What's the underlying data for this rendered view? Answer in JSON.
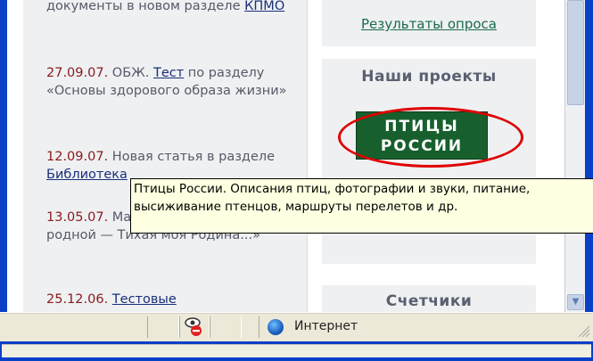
{
  "news": [
    {
      "date": "",
      "text_before": "документы в новом разделе ",
      "link": "КПМО",
      "text_after": ""
    },
    {
      "date": "27.09.07.",
      "text_before": " ОБЖ. ",
      "link": "Тест",
      "text_after": " по разделу «Основы здорового образа жизни»"
    },
    {
      "date": "12.09.07.",
      "text_before": " Новая статья в разделе ",
      "link": "Библиотека",
      "text_after": ""
    },
    {
      "date": "13.05.07.",
      "text_before": " Материалы к уроку «Край родной — Тихая моя Родина...»",
      "link": "",
      "text_after": ""
    },
    {
      "date": "25.12.06.",
      "text_before": " ",
      "link": "Тестовые",
      "text_after": ""
    }
  ],
  "right": {
    "poll_link": "Результаты опроса",
    "projects_title": "Наши проекты",
    "banner_line1": "ПТИЦЫ",
    "banner_line2": "РОССИИ",
    "counters_title": "Счетчики"
  },
  "tooltip": "Птицы России. Описания птиц, фотографии и звуки, питание, высиживание птенцов, маршруты перелетов и др.",
  "statusbar": {
    "zone_label": "Интернет"
  },
  "colors": {
    "frame": "#0a3fc8",
    "highlight_ellipse": "#e00000",
    "banner_bg": "#17602d",
    "tooltip_bg": "#ffffe1"
  }
}
